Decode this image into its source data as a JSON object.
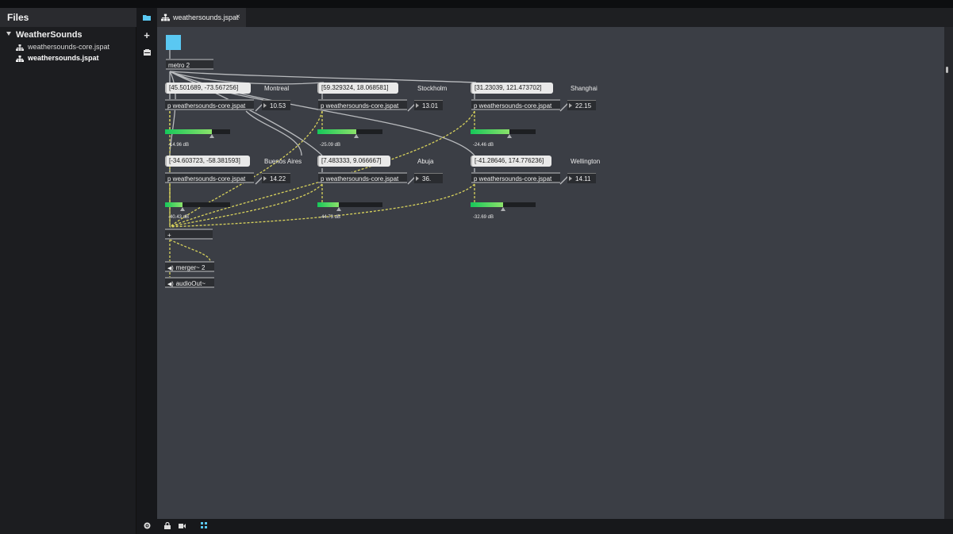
{
  "sidebar": {
    "title": "Files",
    "root": "WeatherSounds",
    "files": [
      {
        "name": "weathersounds-core.jspat",
        "active": false
      },
      {
        "name": "weathersounds.jspat",
        "active": true
      }
    ]
  },
  "tab": {
    "label": "weathersounds.jspat",
    "close": "×"
  },
  "toolbar": {
    "add": "+",
    "clipboard": "▬"
  },
  "patch": {
    "metro": "metro 2",
    "cities": [
      {
        "coords": "[45.501689, -73.567256]",
        "name": "Montreal",
        "subpatch": "p weathersounds-core.jspat",
        "value": "10.53",
        "db": "-14.96 dB",
        "level": 0.72
      },
      {
        "coords": "[59.329324, 18.068581]",
        "name": "Stockholm",
        "subpatch": "p weathersounds-core.jspat",
        "value": "13.01",
        "db": "-25.09 dB",
        "level": 0.6
      },
      {
        "coords": "[31.23039, 121.473702]",
        "name": "Shanghai",
        "subpatch": "p weathersounds-core.jspat",
        "value": "22.15",
        "db": "-24.46 dB",
        "level": 0.6
      },
      {
        "coords": "[-34.603723, -58.381593]",
        "name": "Buenos Aires",
        "subpatch": "p weathersounds-core.jspat",
        "value": "14.22",
        "db": "-40.43 dB",
        "level": 0.27
      },
      {
        "coords": "[7.483333, 9.066667]",
        "name": "Abuja",
        "subpatch": "p weathersounds-core.jspat",
        "value": "36.",
        "db": "-44.73 dB",
        "level": 0.33
      },
      {
        "coords": "[-41.28646, 174.776236]",
        "name": "Wellington",
        "subpatch": "p weathersounds-core.jspat",
        "value": "14.11",
        "db": "-32.69 dB",
        "level": 0.5
      }
    ],
    "sum": "+",
    "merger": "merger~ 2",
    "audio_out": "audioOut~"
  },
  "colors": {
    "canvas": "#3b3e45",
    "accent": "#5ac8f2",
    "meter": "#27d36a",
    "wire_audio": "#d8d25c"
  }
}
